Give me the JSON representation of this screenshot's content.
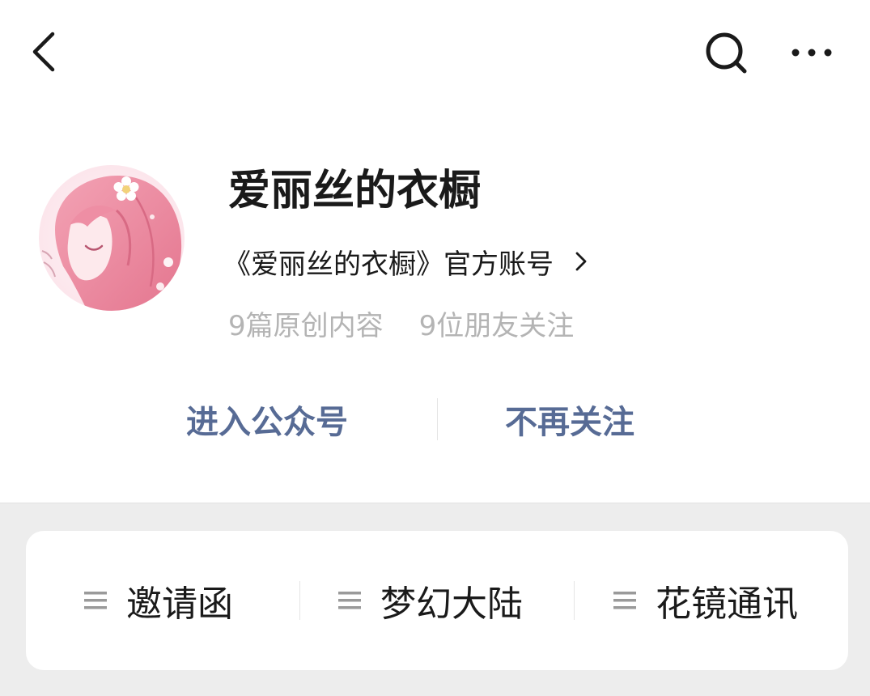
{
  "nav": {
    "back_icon": "chevron-left-icon",
    "search_icon": "search-icon",
    "more_icon": "more-horizontal-icon"
  },
  "profile": {
    "avatar": "pink-haired-girl-avatar",
    "name": "爱丽丝的衣橱",
    "description": "《爱丽丝的衣橱》官方账号",
    "description_icon": "chevron-right-icon",
    "original_content": "9篇原创内容",
    "friends_following": "9位朋友关注"
  },
  "actions": {
    "enter_label": "进入公众号",
    "unfollow_label": "不再关注"
  },
  "menu": {
    "icon": "menu-lines-icon",
    "items": [
      {
        "label": "邀请函"
      },
      {
        "label": "梦幻大陆"
      },
      {
        "label": "花镜通讯"
      }
    ]
  },
  "colors": {
    "link_blue": "#576b95",
    "page_background": "#ededed",
    "muted_gray": "#b4b4b4"
  }
}
